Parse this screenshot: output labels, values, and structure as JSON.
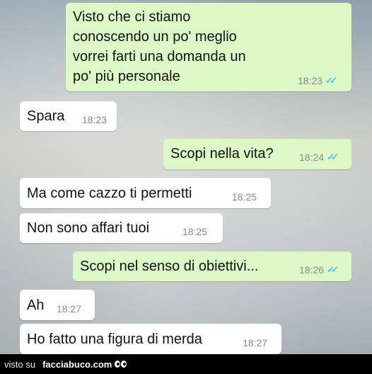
{
  "messages": [
    {
      "direction": "outgoing",
      "lines": [
        "Visto che ci stiamo",
        "conoscendo un po' meglio",
        "vorrei farti una domanda un",
        "po' più personale"
      ],
      "time": "18:23",
      "read": true
    },
    {
      "direction": "incoming",
      "text": "Spara",
      "time": "18:23"
    },
    {
      "direction": "outgoing",
      "text": "Scopi nella vita?",
      "time": "18:24",
      "read": true
    },
    {
      "direction": "incoming",
      "text": "Ma come cazzo ti permetti",
      "time": "18:25"
    },
    {
      "direction": "incoming",
      "text": "Non sono affari tuoi",
      "time": "18:25"
    },
    {
      "direction": "outgoing",
      "text": "Scopi nel senso di obiettivi...",
      "time": "18:26",
      "read": true
    },
    {
      "direction": "incoming",
      "text": "Ah",
      "time": "18:27"
    },
    {
      "direction": "incoming",
      "text": "Ho fatto una figura di merda",
      "time": "18:27"
    }
  ],
  "footer": {
    "prefix": "visto su",
    "site": "facciabuco.com"
  },
  "colors": {
    "outgoing_bubble": "#dcf8c6",
    "incoming_bubble": "#ffffff",
    "read_tick": "#4fc3f7"
  },
  "icons": {
    "read_receipt": "double-check-icon",
    "footer_logo": "eyes-icon"
  }
}
